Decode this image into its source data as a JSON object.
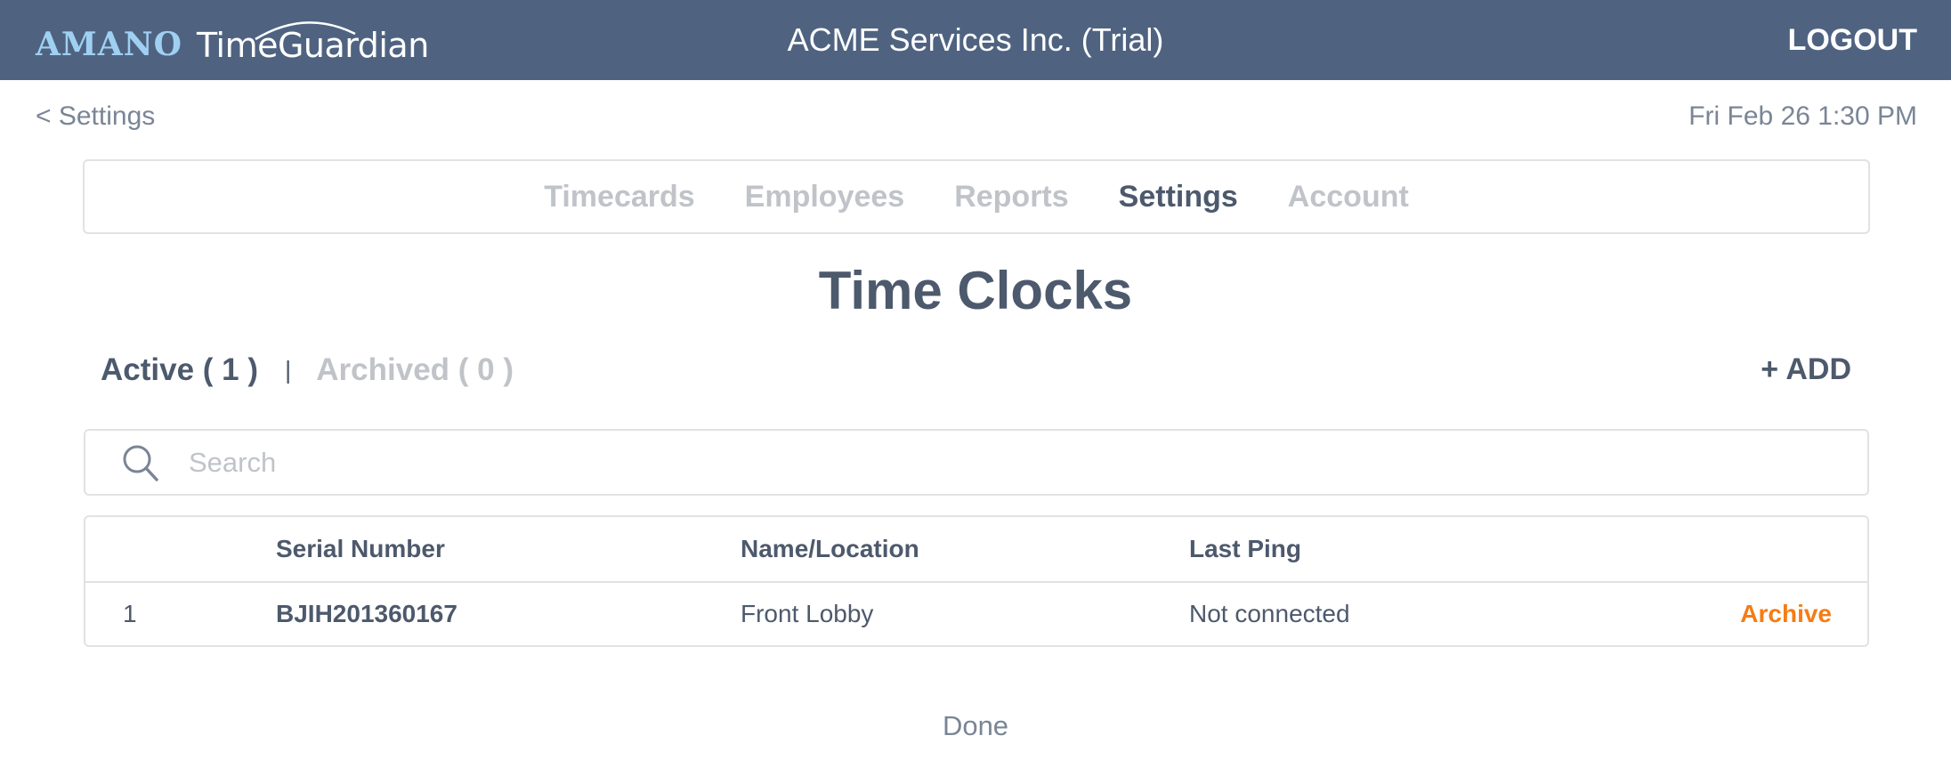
{
  "header": {
    "logo_brand": "AMANO",
    "logo_product": "TimeGuardian",
    "company": "ACME Services Inc. (Trial)",
    "logout_label": "LOGOUT"
  },
  "subheader": {
    "back_label": "< Settings",
    "datetime": "Fri Feb 26 1:30 PM"
  },
  "nav": {
    "tabs": [
      {
        "label": "Timecards",
        "active": false
      },
      {
        "label": "Employees",
        "active": false
      },
      {
        "label": "Reports",
        "active": false
      },
      {
        "label": "Settings",
        "active": true
      },
      {
        "label": "Account",
        "active": false
      }
    ]
  },
  "page": {
    "title": "Time Clocks",
    "filters": {
      "active_label": "Active ( 1 )",
      "separator": "|",
      "archived_label": "Archived ( 0 )"
    },
    "add_label": "+ ADD",
    "search": {
      "placeholder": "Search",
      "value": "",
      "icon": "search-icon"
    },
    "table": {
      "columns": [
        "",
        "Serial Number",
        "Name/Location",
        "Last Ping",
        ""
      ],
      "rows": [
        {
          "index": "1",
          "serial": "BJIH201360167",
          "name": "Front Lobby",
          "last_ping": "Not connected",
          "action": "Archive"
        }
      ]
    },
    "done_label": "Done"
  },
  "colors": {
    "header_bg": "#4f6381",
    "brand_light_blue": "#9fd0f2",
    "text_dark": "#4d596c",
    "text_muted": "#c0c3c8",
    "action_orange": "#f57c14"
  }
}
